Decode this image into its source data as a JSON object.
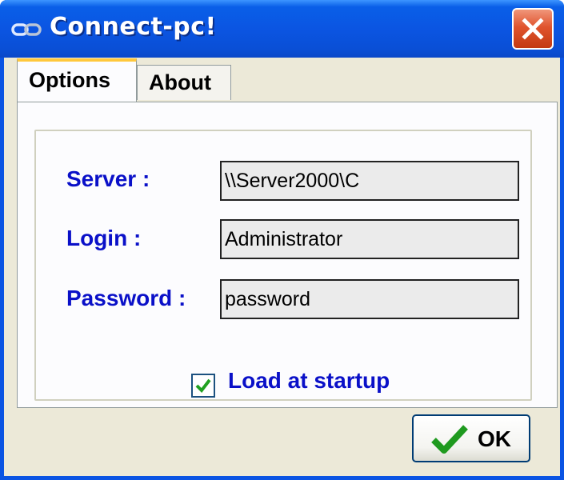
{
  "window": {
    "title": "Connect-pc!",
    "icon": "link-chain-icon",
    "close_icon": "close-icon"
  },
  "tabs": [
    {
      "label": "Options",
      "active": true
    },
    {
      "label": "About",
      "active": false
    }
  ],
  "form": {
    "server_label": "Server :",
    "server_value": "\\\\Server2000\\C",
    "login_label": "Login :",
    "login_value": "Administrator",
    "password_label": "Password :",
    "password_value": "password",
    "load_at_startup_label": "Load at startup",
    "load_at_startup_checked": true
  },
  "ok_button": {
    "label": "OK",
    "icon": "checkmark-icon"
  },
  "colors": {
    "titlebar": "#0a55e2",
    "label_blue": "#0a10c8",
    "close_red": "#e0542e",
    "check_green": "#21a121"
  }
}
